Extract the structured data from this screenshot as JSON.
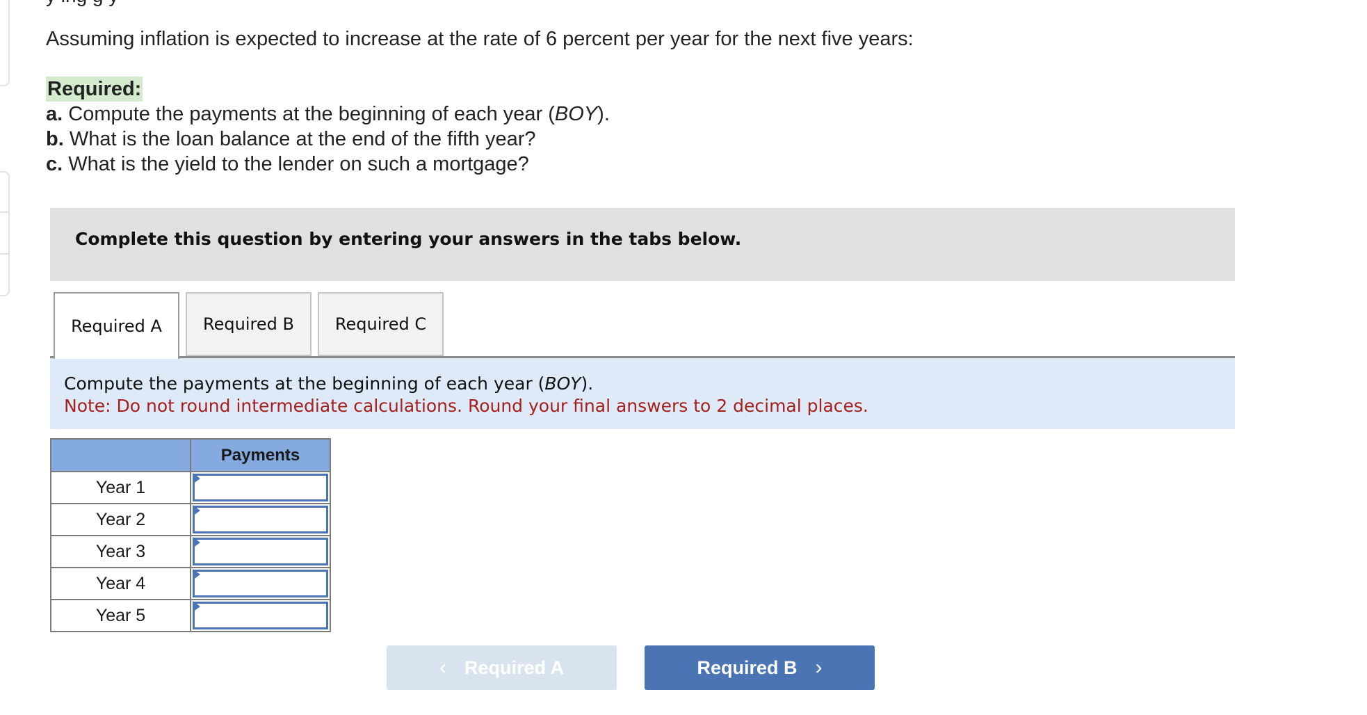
{
  "question": {
    "cutoff_text": "y                    ing g           y",
    "intro": "Assuming inflation is expected to increase at the rate of 6 percent per year for the next five years:",
    "required_label": "Required:",
    "items": [
      {
        "letter": "a.",
        "text": " Compute the payments at the beginning of each year (",
        "em": "BOY",
        "tail": ")."
      },
      {
        "letter": "b.",
        "text": " What is the loan balance at the end of the fifth year?",
        "em": "",
        "tail": ""
      },
      {
        "letter": "c.",
        "text": " What is the yield to the lender on such a mortgage?",
        "em": "",
        "tail": ""
      }
    ]
  },
  "instructions": "Complete this question by entering your answers in the tabs below.",
  "tabs": [
    {
      "label": "Required A",
      "active": true
    },
    {
      "label": "Required B",
      "active": false
    },
    {
      "label": "Required C",
      "active": false
    }
  ],
  "info": {
    "prompt_start": "Compute the payments at the beginning of each year (",
    "prompt_em": "BOY",
    "prompt_end": ").",
    "note": "Note: Do not round intermediate calculations. Round your final answers to 2 decimal places."
  },
  "table": {
    "headers": [
      "",
      "Payments"
    ],
    "rows": [
      {
        "label": "Year 1",
        "value": ""
      },
      {
        "label": "Year 2",
        "value": ""
      },
      {
        "label": "Year 3",
        "value": ""
      },
      {
        "label": "Year 4",
        "value": ""
      },
      {
        "label": "Year 5",
        "value": ""
      }
    ]
  },
  "navigation": {
    "prev_label": "Required A",
    "prev_icon": "chevron-left-icon",
    "prev_disabled": true,
    "next_label": "Required B",
    "next_icon": "chevron-right-icon"
  },
  "colors": {
    "required_highlight": "#d5ebcd",
    "instructions_bg": "#e0e0e0",
    "info_bg": "#deeaf7",
    "note_red": "#a3201c",
    "table_header": "#84aadf",
    "input_border": "#4a74b4",
    "next_button": "#4a74b4",
    "prev_button_disabled": "#d9e3f0"
  }
}
